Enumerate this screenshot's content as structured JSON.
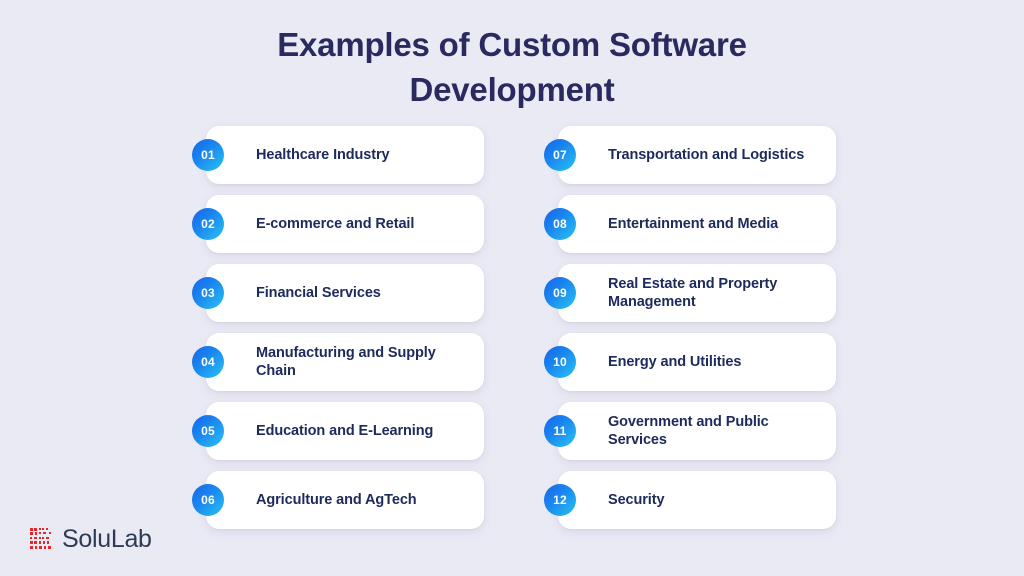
{
  "page": {
    "title": "Examples of Custom Software Development",
    "background_color": "#eaeaf5",
    "title_color": "#2a2a60"
  },
  "theme": {
    "card_background": "#ffffff",
    "label_color": "#1d2a5c",
    "badge_gradient_start": "#1565e8",
    "badge_gradient_end": "#29c3f2",
    "badge_text_color": "#ffffff",
    "brand_mark_color": "#e8262a",
    "brand_text_color": "#2f3b52"
  },
  "columns": [
    {
      "name": "left-column",
      "items": [
        {
          "number": "01",
          "label": "Healthcare Industry"
        },
        {
          "number": "02",
          "label": "E-commerce and Retail"
        },
        {
          "number": "03",
          "label": "Financial Services"
        },
        {
          "number": "04",
          "label": "Manufacturing and Supply Chain"
        },
        {
          "number": "05",
          "label": "Education and E-Learning"
        },
        {
          "number": "06",
          "label": "Agriculture and AgTech"
        }
      ]
    },
    {
      "name": "right-column",
      "items": [
        {
          "number": "07",
          "label": "Transportation and Logistics"
        },
        {
          "number": "08",
          "label": "Entertainment and Media"
        },
        {
          "number": "09",
          "label": "Real Estate and Property Management"
        },
        {
          "number": "10",
          "label": "Energy and Utilities"
        },
        {
          "number": "11",
          "label": "Government and Public Services"
        },
        {
          "number": "12",
          "label": "Security"
        }
      ]
    }
  ],
  "brand": {
    "name": "SoluLab",
    "mark_icon": "qr-code-logo-icon"
  }
}
